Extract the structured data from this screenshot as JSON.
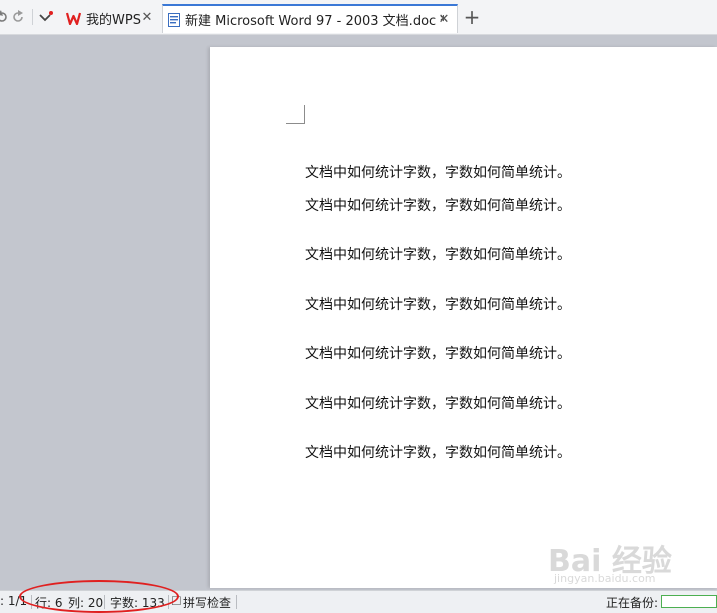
{
  "tabbar": {
    "tabs": [
      {
        "label": "我的WPS",
        "active": false
      },
      {
        "label": "新建 Microsoft Word 97 - 2003 文档.doc *",
        "active": true
      }
    ],
    "icons": {
      "undo": "undo-icon",
      "redo": "redo-icon",
      "dropdown": "dropdown-arrow-icon",
      "wps": "wps-logo-icon",
      "doc": "word-doc-icon",
      "close": "close-icon",
      "new_tab": "plus-icon"
    }
  },
  "document": {
    "paragraphs": [
      "文档中如何统计字数，字数如何简单统计。",
      "文档中如何统计字数，字数如何简单统计。",
      "文档中如何统计字数，字数如何简单统计。",
      "文档中如何统计字数，字数如何简单统计。",
      "文档中如何统计字数，字数如何简单统计。",
      "文档中如何统计字数，字数如何简单统计。",
      "文档中如何统计字数，字数如何简单统计。"
    ]
  },
  "statusbar": {
    "page": ": 1/1",
    "row": "行: 6",
    "col": "列: 20",
    "word_count": "字数: 133",
    "spell_check": "拼写检查",
    "backup": "正在备份:"
  },
  "watermark": {
    "main": "Bai 经验",
    "sub": "jingyan.baidu.com"
  },
  "colors": {
    "active_tab_accent": "#3a78d6",
    "wps_red": "#e02020",
    "highlight_red": "#e02020",
    "backup_green": "#4caf50"
  }
}
